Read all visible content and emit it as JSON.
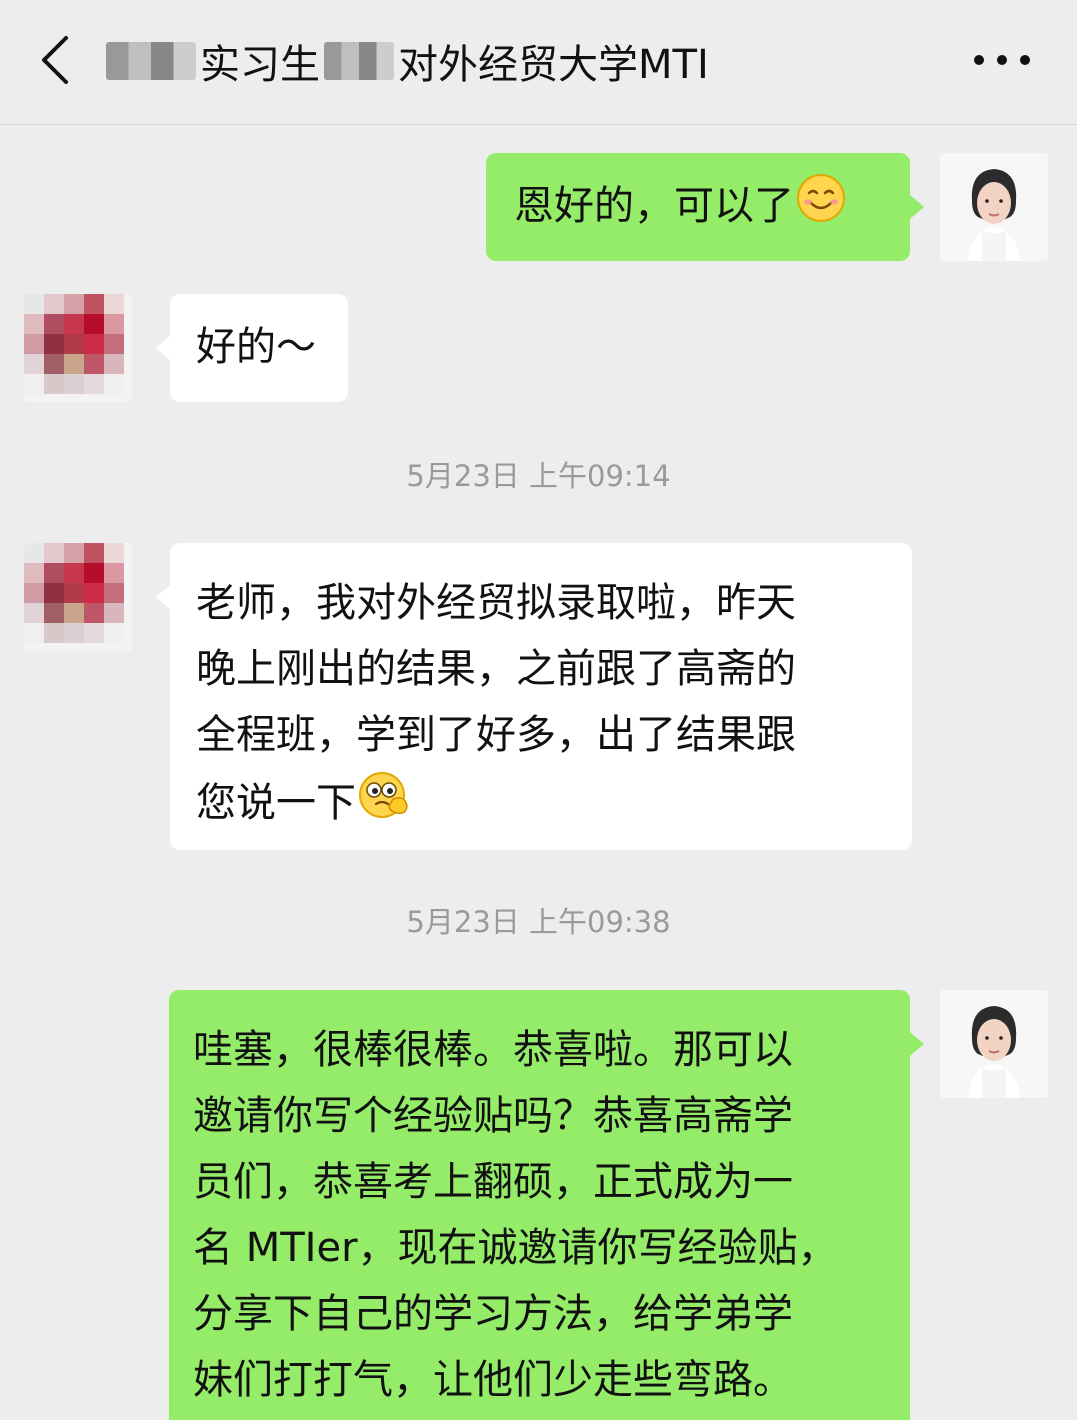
{
  "header": {
    "title_prefix": "",
    "title_middle": "实习生",
    "title_suffix": "对外经贸大学MTI",
    "back_label": "<",
    "more_label": "•••"
  },
  "messages": [
    {
      "side": "right",
      "text": "恩好的，可以了",
      "emoji": "smile-emoji"
    },
    {
      "side": "left",
      "text": "好的～"
    },
    {
      "side": "time",
      "text": "5月23日 上午09:14"
    },
    {
      "side": "left",
      "lines": [
        "老师，我对外经贸拟录取啦，昨天",
        "晚上刚出的结果，之前跟了高斋的",
        "全程班，学到了好多，出了结果跟",
        "您说一下"
      ],
      "emoji": "thinking-emoji"
    },
    {
      "side": "time",
      "text": "5月23日 上午09:38"
    },
    {
      "side": "right",
      "lines": [
        "哇塞，很棒很棒。恭喜啦。那可以",
        "邀请你写个经验贴吗？恭喜高斋学",
        "员们，恭喜考上翻硕，正式成为一",
        "名 MTIer，现在诚邀请你写经验贴，",
        "分享下自己的学习方法，给学弟学",
        "妹们打打气，让他们少走些弯路。"
      ]
    }
  ],
  "colors": {
    "background": "#ededed",
    "green_bubble": "#95ec69",
    "white_bubble": "#ffffff",
    "timestamp": "#9a9a9a"
  }
}
